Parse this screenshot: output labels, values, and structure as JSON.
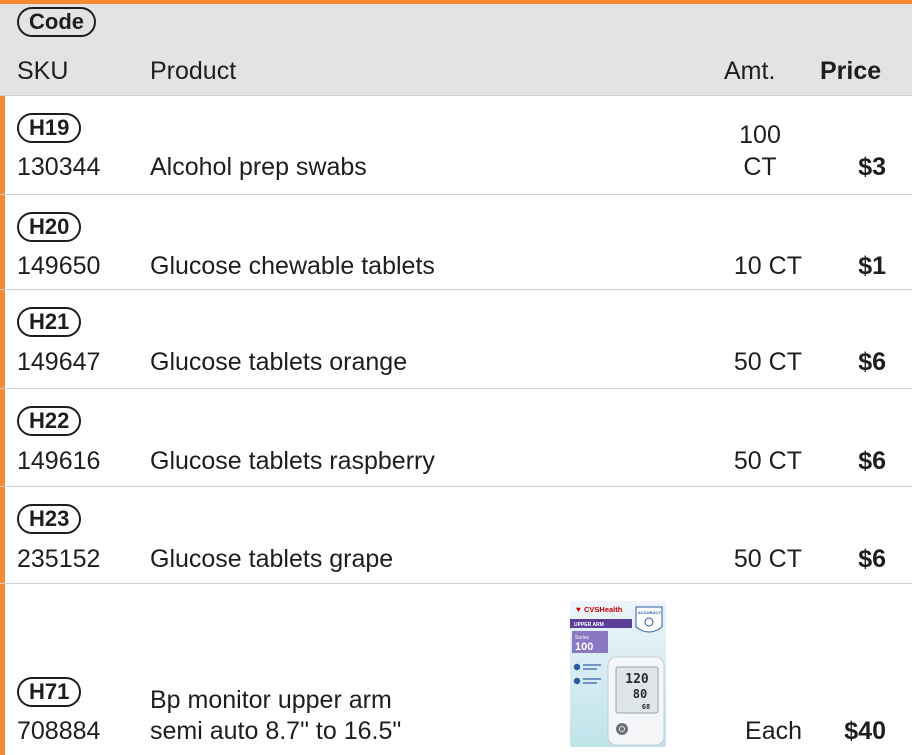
{
  "header": {
    "code_label": "Code",
    "sku_label": "SKU",
    "product_label": "Product",
    "amt_label": "Amt.",
    "price_label": "Price"
  },
  "rows": [
    {
      "code": "H19",
      "sku": "130344",
      "product": "Alcohol prep swabs",
      "amt_line1": "100",
      "amt_line2": "CT",
      "price": "$3"
    },
    {
      "code": "H20",
      "sku": "149650",
      "product": "Glucose chewable tablets",
      "amt": "10 CT",
      "price": "$1"
    },
    {
      "code": "H21",
      "sku": "149647",
      "product": "Glucose tablets orange",
      "amt": "50 CT",
      "price": "$6"
    },
    {
      "code": "H22",
      "sku": "149616",
      "product": "Glucose tablets raspberry",
      "amt": "50 CT",
      "price": "$6"
    },
    {
      "code": "H23",
      "sku": "235152",
      "product": "Glucose tablets grape",
      "amt": "50 CT",
      "price": "$6"
    },
    {
      "code": "H71",
      "sku": "708884",
      "product_line1": "Bp monitor upper arm",
      "product_line2": "semi auto 8.7\" to 16.5\"",
      "amt": "Each",
      "price": "$40"
    }
  ],
  "product_image": {
    "brand": "CVSHealth",
    "badge": "ACCURACY",
    "type_label": "UPPER ARM",
    "series_label": "Series",
    "series_number": "100",
    "display_sys": "120",
    "display_dia": "80",
    "display_pulse": "68"
  },
  "colors": {
    "accent": "#f58a33",
    "header_bg": "#e3e3e3",
    "text": "#1e1e1e"
  }
}
